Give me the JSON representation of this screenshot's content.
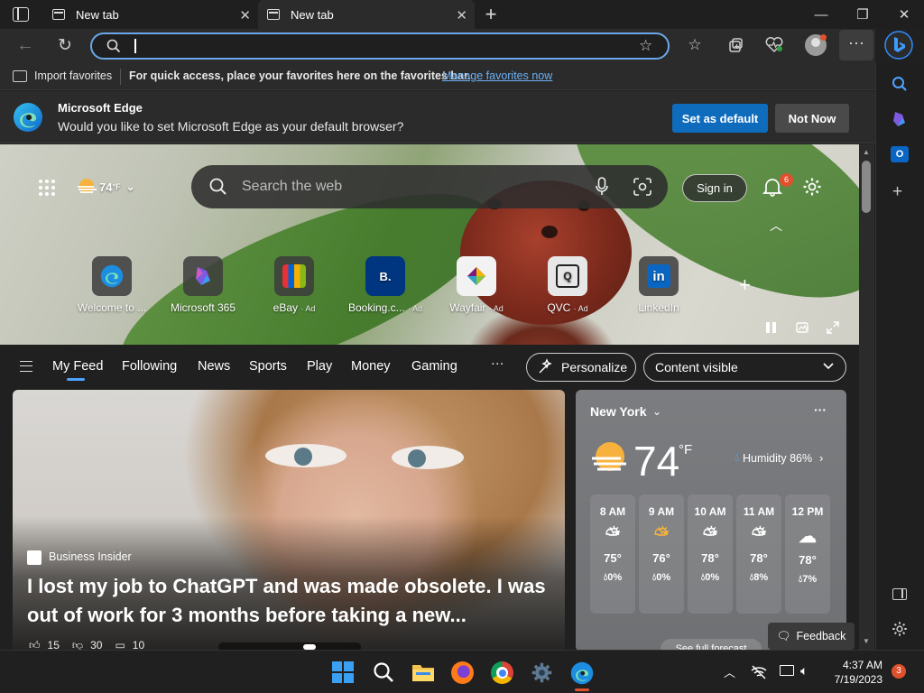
{
  "tabs": [
    {
      "title": "New tab"
    },
    {
      "title": "New tab"
    }
  ],
  "favorites_bar": {
    "import_label": "Import favorites",
    "message": "For quick access, place your favorites here on the favorites bar.",
    "link": "Manage favorites now"
  },
  "default_prompt": {
    "app_name": "Microsoft Edge",
    "question": "Would you like to set Microsoft Edge as your default browser?",
    "primary_button": "Set as default",
    "secondary_button": "Not Now"
  },
  "newtab": {
    "weather_temp": "74",
    "weather_unit": "°F",
    "search_placeholder": "Search the web",
    "sign_in": "Sign in",
    "notification_count": "6"
  },
  "quick_links": [
    {
      "label": "Welcome to ...",
      "ad": ""
    },
    {
      "label": "Microsoft 365",
      "ad": ""
    },
    {
      "label": "eBay",
      "ad": "· Ad"
    },
    {
      "label": "Booking.c...",
      "ad": "· Ad"
    },
    {
      "label": "Wayfair",
      "ad": "· Ad"
    },
    {
      "label": "QVC",
      "ad": "· Ad"
    },
    {
      "label": "LinkedIn",
      "ad": ""
    }
  ],
  "feed_nav": {
    "items": [
      "My Feed",
      "Following",
      "News",
      "Sports",
      "Play",
      "Money",
      "Gaming"
    ],
    "more": "···",
    "personalize": "Personalize",
    "content_visible": "Content visible"
  },
  "article": {
    "source": "Business Insider",
    "headline": "I lost my job to ChatGPT and was made obsolete. I was out of work for 3 months before taking a new...",
    "likes": "15",
    "dislikes": "30",
    "comments": "10"
  },
  "weather_card": {
    "city": "New York",
    "temp": "74",
    "unit": "°F",
    "humidity": "Humidity 86%",
    "hours": [
      {
        "time": "8 AM",
        "temp": "75°",
        "precip": "0%"
      },
      {
        "time": "9 AM",
        "temp": "76°",
        "precip": "0%"
      },
      {
        "time": "10 AM",
        "temp": "78°",
        "precip": "0%"
      },
      {
        "time": "11 AM",
        "temp": "78°",
        "precip": "8%"
      },
      {
        "time": "12 PM",
        "temp": "78°",
        "precip": "7%"
      }
    ],
    "see_full": "See full forecast",
    "feedback": "Feedback"
  },
  "taskbar": {
    "time": "4:37 AM",
    "date": "7/19/2023",
    "notification_count": "3"
  },
  "colors": {
    "accent_blue": "#0f6cbd",
    "address_border": "#6aa7e8",
    "link": "#6cb0f5",
    "badge": "#e0502d"
  }
}
